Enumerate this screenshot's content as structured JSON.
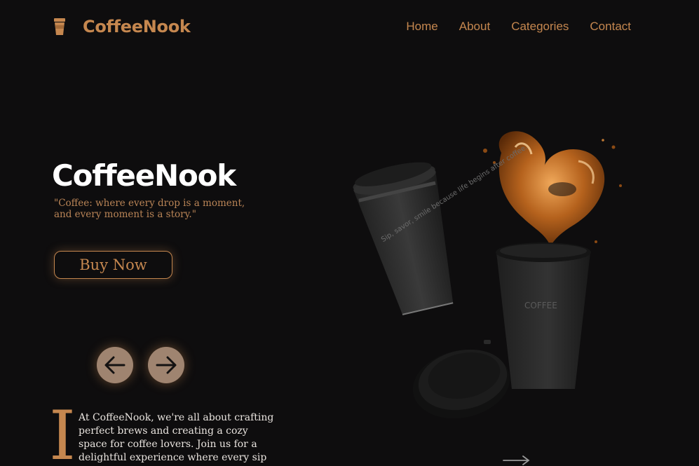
{
  "brand": {
    "name": "CoffeeNook",
    "icon": "coffee-cup-icon"
  },
  "nav": [
    {
      "label": "Home"
    },
    {
      "label": "About"
    },
    {
      "label": "Categories"
    },
    {
      "label": "Contact"
    }
  ],
  "hero": {
    "title": "CoffeeNook",
    "quote": "\"Coffee: where every drop is a moment, and every moment is a story.\"",
    "cta_label": "Buy Now",
    "prev_icon": "arrow-left-icon",
    "next_icon": "arrow-right-icon"
  },
  "about": {
    "drop_cap": "I",
    "text": "At CoffeeNook, we're all about crafting perfect brews and creating a cozy space for coffee lovers. Join us for a delightful experience where every sip tells a story."
  },
  "art": {
    "cup_text": "Sip, savor, smile because life begins after coffee.",
    "cup2_text": "COFFEE"
  },
  "colors": {
    "accent": "#c5874f",
    "background": "#0e0d0e",
    "arrow_bg": "#9f8470"
  }
}
